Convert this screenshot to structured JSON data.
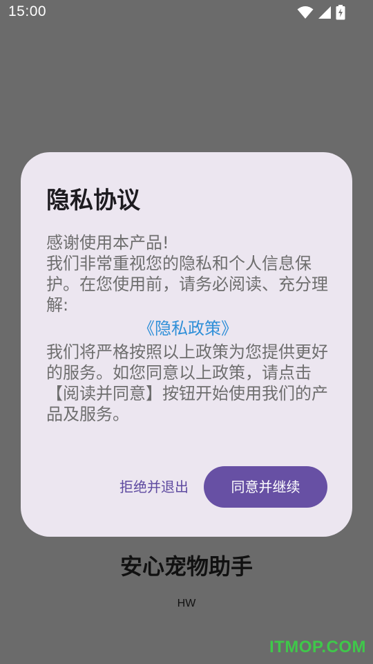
{
  "status_bar": {
    "time": "15:00",
    "icons": [
      "wifi-icon",
      "cellular-signal-icon",
      "battery-charging-icon"
    ]
  },
  "app": {
    "title": "安心宠物助手",
    "subtitle": "HW"
  },
  "dialog": {
    "title": "隐私协议",
    "intro_lines": [
      "感谢使用本产品!",
      "我们非常重视您的隐私和个人信息保护。在您使用前，请务必阅读、充分理解:"
    ],
    "policy_link": "《隐私政策》",
    "closing": "我们将严格按照以上政策为您提供更好的服务。如您同意以上政策，请点击【阅读并同意】按钮开始使用我们的产品及服务。",
    "decline_label": "拒绝并退出",
    "accept_label": "同意并继续"
  },
  "watermark": "ITMOP.COM",
  "colors": {
    "scrim": "#6b6b6b",
    "dialog_bg": "#ece6f0",
    "primary": "#6750a4",
    "link": "#2f8fd8",
    "body_text": "#6e6e6e"
  }
}
